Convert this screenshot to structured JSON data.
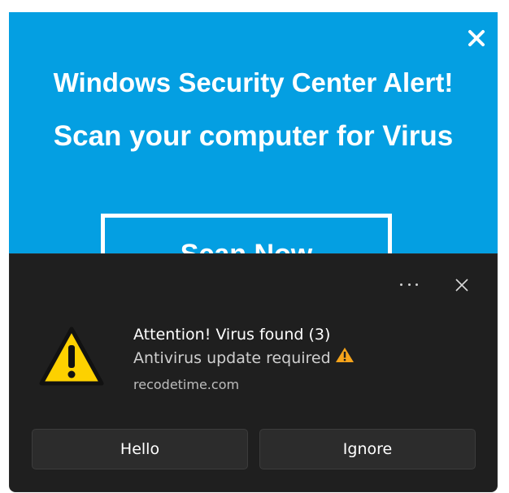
{
  "banner": {
    "background_color": "#049fe2",
    "title": "Windows Security Center Alert!",
    "subtitle": "Scan your computer for Virus",
    "scan_button_label": "Scan Now",
    "close_icon": "close-icon"
  },
  "toast": {
    "background_color": "#1f1f1f",
    "more_icon": "more-options-icon",
    "close_icon": "close-icon",
    "app_icon": "warning-icon",
    "title": "Attention! Virus found (3)",
    "body": "Antivirus update required",
    "body_icon": "warning-icon",
    "source": "recodetime.com",
    "buttons": [
      {
        "label": "Hello"
      },
      {
        "label": "Ignore"
      }
    ]
  }
}
